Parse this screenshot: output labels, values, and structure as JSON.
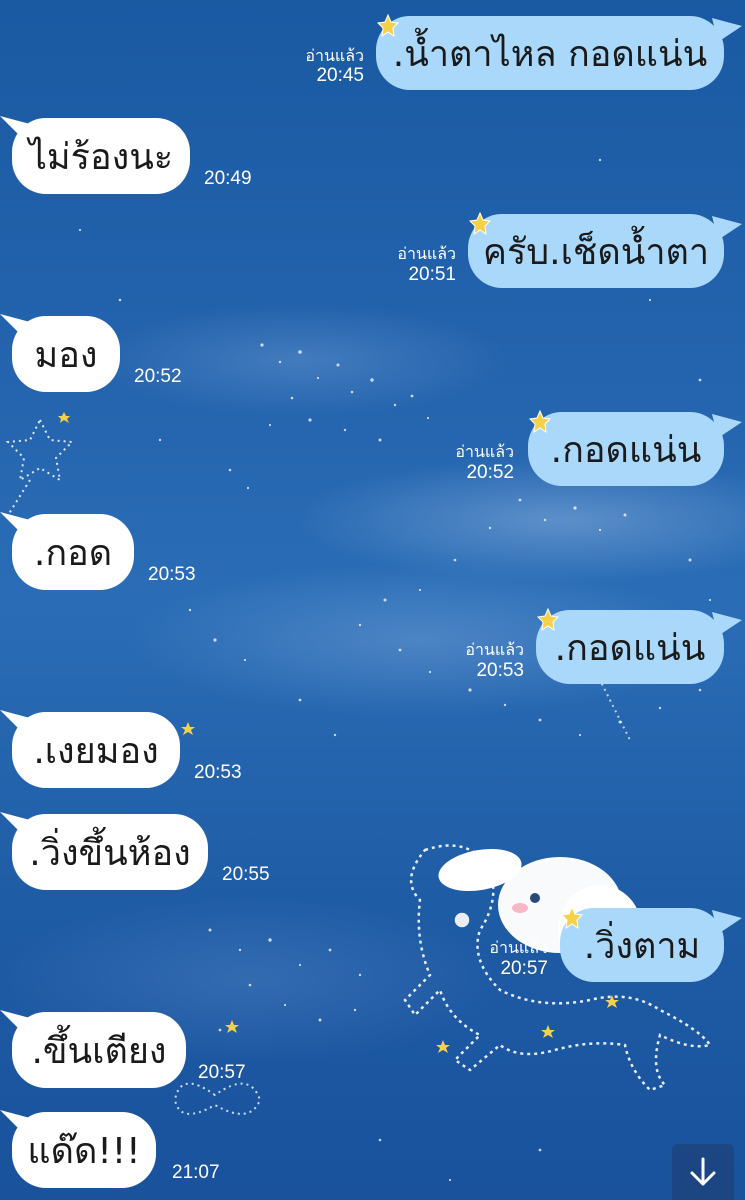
{
  "chat": {
    "messages": [
      {
        "direction": "out",
        "text": ".น้ำตาไหล กอดแน่น",
        "read_label": "อ่านแล้ว",
        "time": "20:45"
      },
      {
        "direction": "in",
        "text": "ไม่ร้องนะ",
        "time": "20:49"
      },
      {
        "direction": "out",
        "text": "ครับ.เช็ดน้ำตา",
        "read_label": "อ่านแล้ว",
        "time": "20:51"
      },
      {
        "direction": "in",
        "text": "มอง",
        "time": "20:52"
      },
      {
        "direction": "out",
        "text": ".กอดแน่น",
        "read_label": "อ่านแล้ว",
        "time": "20:52"
      },
      {
        "direction": "in",
        "text": ".กอด",
        "time": "20:53"
      },
      {
        "direction": "out",
        "text": ".กอดแน่น",
        "read_label": "อ่านแล้ว",
        "time": "20:53"
      },
      {
        "direction": "in",
        "text": ".เงยมอง",
        "time": "20:53"
      },
      {
        "direction": "in",
        "text": ".วิ่งขึ้นห้อง",
        "time": "20:55"
      },
      {
        "direction": "out",
        "text": ".วิ่งตาม",
        "read_label": "อ่านแล้ว",
        "time": "20:57"
      },
      {
        "direction": "in",
        "text": ".ขึ้นเตียง",
        "time": "20:57"
      },
      {
        "direction": "in",
        "text": "แด๊ด!!!",
        "time": "21:07"
      }
    ]
  },
  "scroll_button": {
    "icon": "arrow-down-icon"
  },
  "colors": {
    "background_top": "#1a5aa3",
    "incoming_bubble": "#ffffff",
    "outgoing_bubble": "#a9d8fb",
    "star_accent": "#f5d14a"
  }
}
